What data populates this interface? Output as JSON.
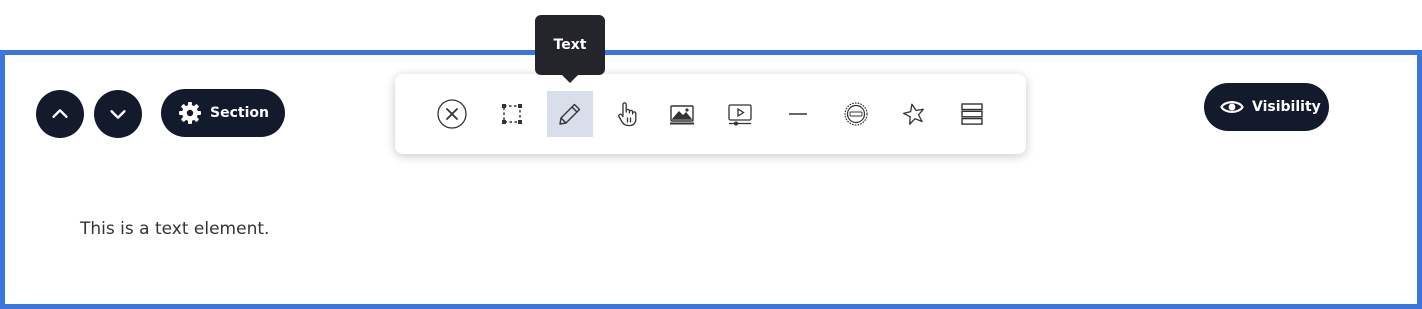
{
  "controls": {
    "move_up_icon": "chevron-up-icon",
    "move_down_icon": "chevron-down-icon",
    "section_label": "Section",
    "section_icon": "gear-icon",
    "visibility_label": "Visibility",
    "visibility_icon": "eye-icon"
  },
  "toolbar": {
    "tooltip": "Text",
    "active_tool": "Text",
    "tools": [
      {
        "icon": "close-circle-icon"
      },
      {
        "icon": "box-select-icon"
      },
      {
        "icon": "pencil-icon",
        "label": "Text"
      },
      {
        "icon": "hand-pointer-icon"
      },
      {
        "icon": "image-icon"
      },
      {
        "icon": "video-icon"
      },
      {
        "icon": "line-icon"
      },
      {
        "icon": "logo-badge-icon"
      },
      {
        "icon": "star-icon"
      },
      {
        "icon": "rows-icon"
      }
    ]
  },
  "content": {
    "text_element": "This is a text element."
  },
  "colors": {
    "frame_border": "#3a76dc",
    "button_bg": "#131a2b",
    "tooltip_bg": "#24252b",
    "active_tool_bg": "#d9deea"
  }
}
